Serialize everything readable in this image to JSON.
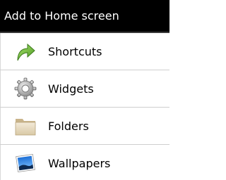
{
  "dialog": {
    "title": "Add to Home screen"
  },
  "items": [
    {
      "label": "Shortcuts",
      "icon": "shortcut-arrow-icon"
    },
    {
      "label": "Widgets",
      "icon": "gear-icon"
    },
    {
      "label": "Folders",
      "icon": "folder-icon"
    },
    {
      "label": "Wallpapers",
      "icon": "wallpaper-icon"
    }
  ],
  "colors": {
    "title_bg": "#000000",
    "title_text": "#ffffff",
    "list_bg": "#ffffff",
    "divider": "#cfcfcf",
    "shortcut_green": "#6cb83a"
  }
}
